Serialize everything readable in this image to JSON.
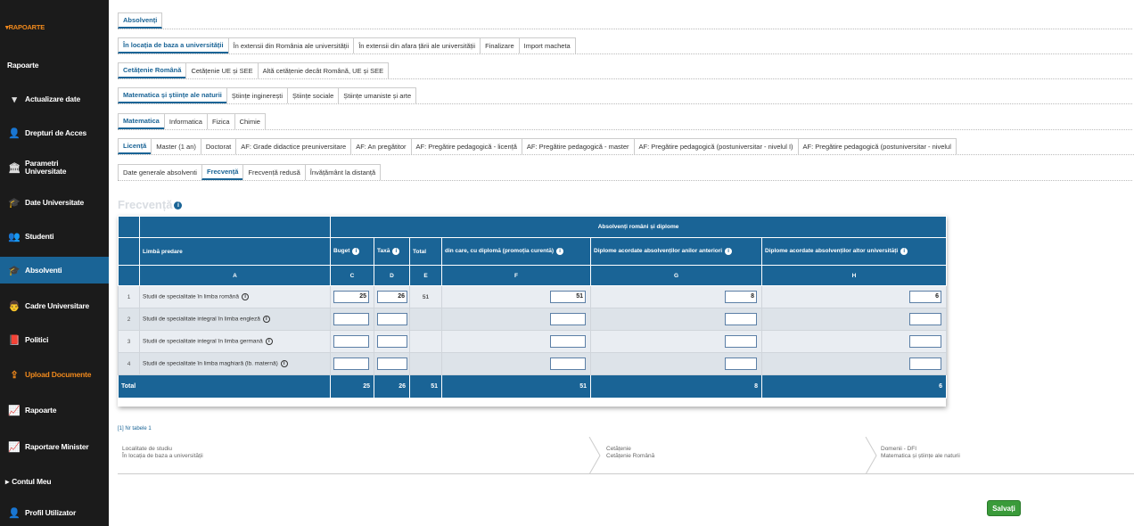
{
  "sidebar": {
    "header": "RAPOARTE",
    "items": [
      {
        "label": "Rapoarte",
        "icon": "none"
      },
      {
        "label": "Actualizare date",
        "icon": "caret-down-icon"
      },
      {
        "label": "Drepturi de Acces",
        "icon": "user-icon"
      },
      {
        "label": "Parametri Universitate",
        "icon": "building-icon"
      },
      {
        "label": "Date Universitate",
        "icon": "graduation-cap-icon"
      },
      {
        "label": "Studenti",
        "icon": "users-icon"
      },
      {
        "label": "Absolventi",
        "icon": "graduation-cap-icon"
      },
      {
        "label": "Cadre Universitare",
        "icon": "teacher-icon"
      },
      {
        "label": "Politici",
        "icon": "book-icon"
      },
      {
        "label": "Upload Documente",
        "icon": "upload-icon"
      },
      {
        "label": "Rapoarte",
        "icon": "chart-icon"
      },
      {
        "label": "Raportare Minister",
        "icon": "chart-icon"
      },
      {
        "label": "Contul Meu",
        "icon": "caret-right-icon"
      },
      {
        "label": "Profil Utilizator",
        "icon": "user-icon"
      }
    ]
  },
  "tabs": {
    "row0": [
      "Absolvenți"
    ],
    "row1": [
      "În locația de baza a universității",
      "În extensii din România ale universității",
      "În extensii din afara țării ale universității",
      "Finalizare",
      "Import macheta"
    ],
    "row2": [
      "Cetățenie Română",
      "Cetățenie UE și SEE",
      "Altă cetățenie decât Română, UE și SEE"
    ],
    "row3": [
      "Matematica și științe ale naturii",
      "Științe inginerești",
      "Științe sociale",
      "Științe umaniste și arte"
    ],
    "row4": [
      "Matematica",
      "Informatica",
      "Fizica",
      "Chimie"
    ],
    "row5": [
      "Licență",
      "Master (1 an)",
      "Doctorat",
      "AF: Grade didactice preuniversitare",
      "AF: An pregătitor",
      "AF: Pregătire pedagogică - licență",
      "AF: Pregătire pedagogică - master",
      "AF: Pregătire pedagogică (postuniversitar - nivelul I)",
      "AF: Pregătire pedagogică (postuniversitar - nivelul"
    ],
    "row6": [
      "Date generale absolventi",
      "Frecvență",
      "Frecvență redusă",
      "Învățământ la distanță"
    ]
  },
  "section_title": "Frecvență",
  "table": {
    "group_header": "Absolvenți români și diplome",
    "col_lang": "Limbă predare",
    "col_buget": "Buget",
    "col_taxa": "Taxă",
    "col_total": "Total",
    "col_f": "din care, cu diplomă (promoția curentă)",
    "col_g": "Diplome acordate absolvenților anilor anteriori",
    "col_h": "Diplome acordate absolvenților altor universități",
    "letters": [
      "A",
      "C",
      "D",
      "E",
      "F",
      "G",
      "H"
    ],
    "rows": [
      {
        "n": "1",
        "label": "Studii de specialitate în limba română",
        "buget": "25",
        "taxa": "26",
        "total": "51",
        "f": "51",
        "g": "8",
        "h": "6"
      },
      {
        "n": "2",
        "label": "Studii de specialitate integral în limba engleză",
        "buget": "",
        "taxa": "",
        "total": "",
        "f": "",
        "g": "",
        "h": ""
      },
      {
        "n": "3",
        "label": "Studii de specialitate integral în limba germană",
        "buget": "",
        "taxa": "",
        "total": "",
        "f": "",
        "g": "",
        "h": ""
      },
      {
        "n": "4",
        "label": "Studii de specialitate în limba maghiară (lb. maternă)",
        "buget": "",
        "taxa": "",
        "total": "",
        "f": "",
        "g": "",
        "h": ""
      }
    ],
    "total": {
      "label": "Total",
      "buget": "25",
      "taxa": "26",
      "total": "51",
      "f": "51",
      "g": "8",
      "h": "6"
    }
  },
  "note": "[1] Nr tabele 1",
  "summary": [
    {
      "title": "Localitate de studiu",
      "value": "În locația de baza a universității"
    },
    {
      "title": "Cetățenie",
      "value": "Cetățenie Română"
    },
    {
      "title": "Domenii - DFI",
      "value": "Matematica și științe ale naturii"
    }
  ],
  "save_label": "Salvați"
}
